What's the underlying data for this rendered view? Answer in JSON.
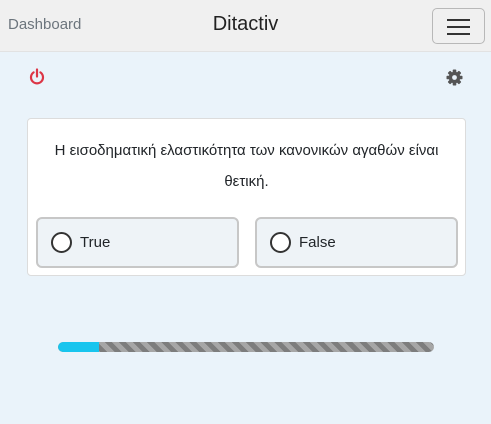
{
  "navbar": {
    "link_label": "Dashboard",
    "brand": "Ditactiv",
    "menu_icon": "hamburger-icon"
  },
  "toolbar": {
    "logout_icon": "power-icon",
    "settings_icon": "gear-icon",
    "logout_color": "#dc3545",
    "settings_color": "#555555"
  },
  "quiz": {
    "question": "Η εισοδηματική ελαστικότητα των κανονικών αγαθών είναι θετική.",
    "options": [
      {
        "label": "True",
        "selected": false
      },
      {
        "label": "False",
        "selected": false
      }
    ]
  },
  "progress": {
    "fraction": 0.11,
    "fill_color": "#18c5ee"
  }
}
